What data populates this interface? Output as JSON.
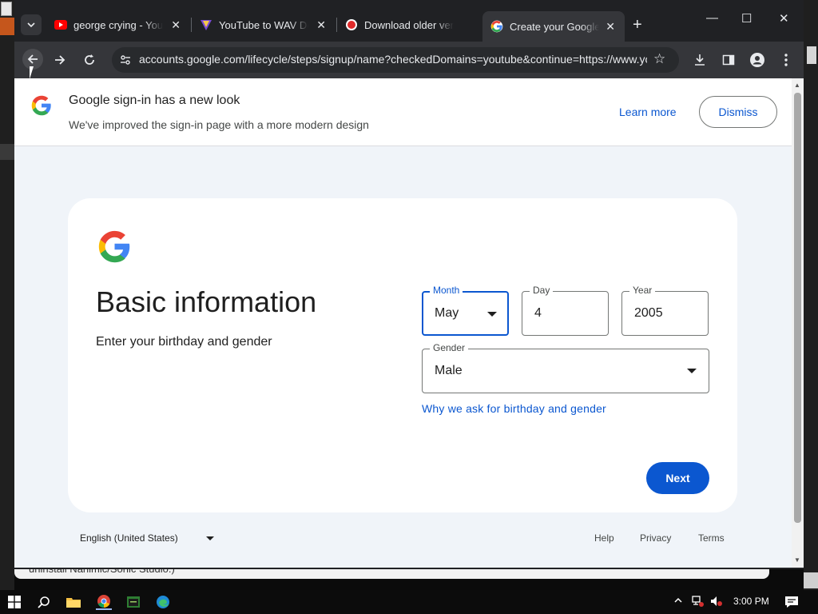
{
  "desktop": {
    "behind_window_text": "uninstall Nahimic/Sonic Studio.)"
  },
  "browser": {
    "tabs": [
      {
        "title": "george crying - YouTube",
        "favicon": "youtube-icon",
        "active": false
      },
      {
        "title": "YouTube to WAV Downloader",
        "favicon": "vshield-icon",
        "active": false
      },
      {
        "title": "Download older versions",
        "favicon": "record-icon",
        "active": false
      },
      {
        "title": "Create your Google Account",
        "favicon": "google-icon",
        "active": true
      }
    ],
    "close_glyph": "✕",
    "new_tab_glyph": "+",
    "url": "accounts.google.com/lifecycle/steps/signup/name?checkedDomains=youtube&continue=https://www.youtube.com",
    "window_controls": {
      "minimize": "—",
      "maximize": "☐",
      "close": "✕"
    }
  },
  "banner": {
    "title": "Google sign-in has a new look",
    "subtitle": "We've improved the sign-in page with a more modern design",
    "learn_more": "Learn more",
    "dismiss": "Dismiss"
  },
  "form": {
    "heading": "Basic information",
    "subheading": "Enter your birthday and gender",
    "month": {
      "label": "Month",
      "value": "May"
    },
    "day": {
      "label": "Day",
      "value": "4"
    },
    "year": {
      "label": "Year",
      "value": "2005"
    },
    "gender": {
      "label": "Gender",
      "value": "Male"
    },
    "why_link": "Why we ask for birthday and gender",
    "next_button": "Next"
  },
  "footer": {
    "language": "English (United States)",
    "help": "Help",
    "privacy": "Privacy",
    "terms": "Terms"
  },
  "taskbar": {
    "time": "3:00 PM"
  },
  "colors": {
    "accent": "#0b57d0",
    "page_bg": "#f0f4f9",
    "chrome_dark": "#202124"
  }
}
